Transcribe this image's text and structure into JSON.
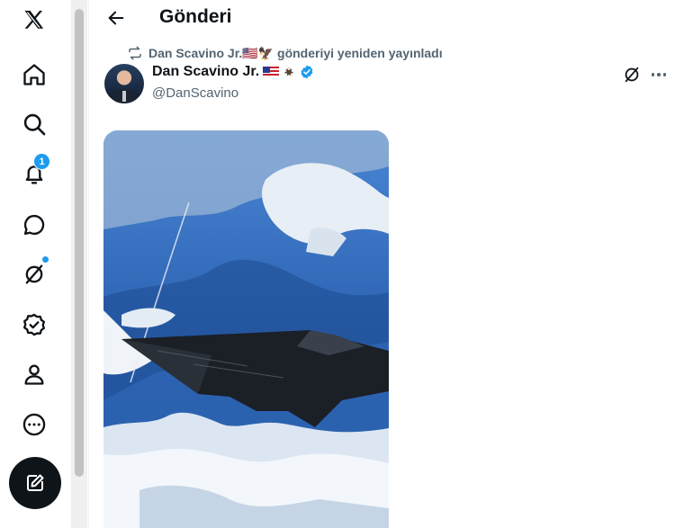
{
  "header": {
    "title": "Gönderi"
  },
  "repost": {
    "text": "Dan Scavino Jr.🇺🇸🦅 gönderiyi yeniden yayınladı",
    "name": "Dan Scavino Jr.",
    "suffix": "gönderiyi yeniden yayınladı"
  },
  "post": {
    "author_name": "Dan Scavino Jr.",
    "handle": "@DanScavino",
    "verified": true
  },
  "nav": {
    "notifications_badge": "1",
    "items": [
      "x-logo-icon",
      "home-icon",
      "search-icon",
      "notifications-icon",
      "messages-icon",
      "grok-icon",
      "verified-icon",
      "profile-icon",
      "more-icon",
      "compose-icon"
    ]
  },
  "colors": {
    "accent": "#1d9bf0",
    "text": "#0f1419",
    "secondary": "#536471"
  }
}
